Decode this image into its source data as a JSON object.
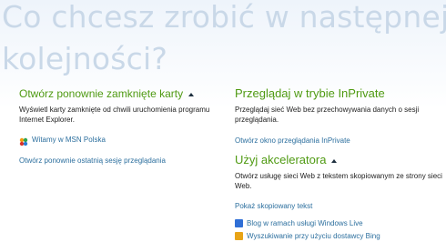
{
  "header": {
    "line1": "Co chcesz zrobić w następnej",
    "line2": "kolejności?"
  },
  "reopen_tabs": {
    "title": "Otwórz ponownie zamknięte karty",
    "description": "Wyświetl karty zamknięte od chwili uruchomienia programu Internet Explorer.",
    "items": [
      {
        "icon": "msn-butterfly-icon",
        "label": "Witamy w MSN Polska"
      }
    ],
    "reopen_session": "Otwórz ponownie ostatnią sesję przeglądania"
  },
  "inprivate": {
    "title": "Przeglądaj w trybie InPrivate",
    "description": "Przeglądaj sieć Web bez przechowywania danych o sesji przeglądania.",
    "link": "Otwórz okno przeglądania InPrivate"
  },
  "accelerator": {
    "title": "Użyj akceleratora",
    "description": "Otwórz usługę sieci Web z tekstem skopiowanym ze strony sieci Web.",
    "show_copied": "Pokaż skopiowany tekst",
    "items": [
      {
        "icon": "windows-live-icon",
        "label": "Blog w ramach usługi Windows Live",
        "color": "#2f6fd6"
      },
      {
        "icon": "bing-icon",
        "label": "Wyszukiwanie przy użyciu dostawcy Bing",
        "color": "#e8a417"
      }
    ]
  },
  "colors": {
    "section_title": "#4f9a12",
    "link": "#2c6f9e",
    "headline": "#c9d8e8"
  }
}
